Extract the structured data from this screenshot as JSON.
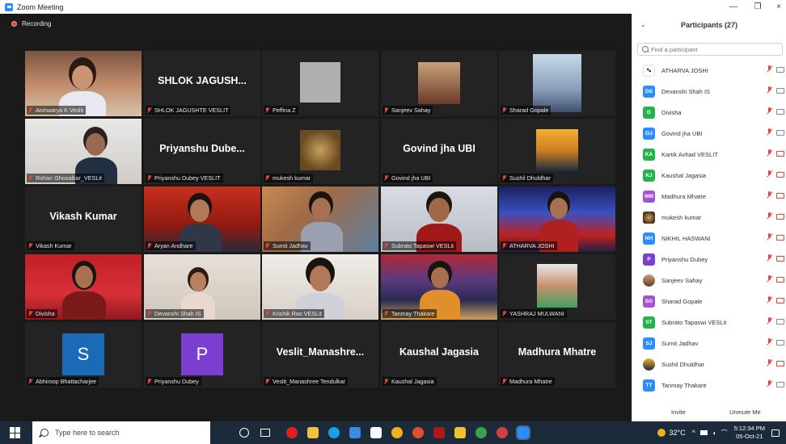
{
  "window": {
    "title": "Zoom Meeting",
    "minimize": "—",
    "restore": "❐",
    "close": "×"
  },
  "recording": {
    "label": "Recording"
  },
  "tiles": [
    {
      "name": "Aishwarya K Veslit",
      "big": ""
    },
    {
      "name": "SHLOK JAGUSHTE VESLIT",
      "big": "SHLOK JAGUSH..."
    },
    {
      "name": "Peffina Z",
      "big": ""
    },
    {
      "name": "Sanjeev Sahay",
      "big": ""
    },
    {
      "name": "Sharad Gopale",
      "big": ""
    },
    {
      "name": "Rohan Ghosalkar_VESLit",
      "big": ""
    },
    {
      "name": "Priyanshu Dubey VESLIT",
      "big": "Priyanshu  Dube..."
    },
    {
      "name": "mukesh kumar",
      "big": ""
    },
    {
      "name": "Govind jha UBI",
      "big": "Govind jha UBI"
    },
    {
      "name": "Sushil Dhuldhar",
      "big": ""
    },
    {
      "name": "Vikash Kumar",
      "big": "Vikash Kumar"
    },
    {
      "name": "Aryan Andhare",
      "big": ""
    },
    {
      "name": "Sumit Jadhav",
      "big": ""
    },
    {
      "name": "Subrato Tapaswi VESLit",
      "big": ""
    },
    {
      "name": "ATHARVA JOSHI",
      "big": ""
    },
    {
      "name": "Divisha",
      "big": ""
    },
    {
      "name": "Devanshi Shah IS",
      "big": ""
    },
    {
      "name": "Krishik Rao VESLit",
      "big": ""
    },
    {
      "name": "Tanmay Thakare",
      "big": ""
    },
    {
      "name": "YASHRAJ MULWANI",
      "big": ""
    },
    {
      "name": "Abhiroop Bhattacharjee",
      "big": "",
      "avatar": "S"
    },
    {
      "name": "Priyanshu Dubey",
      "big": "",
      "avatar": "P"
    },
    {
      "name": "Veslit_Manashree Tendulkar",
      "big": "Veslit_Manashre..."
    },
    {
      "name": "Kaushal Jagasia",
      "big": "Kaushal Jagasia"
    },
    {
      "name": "Madhura Mhatre",
      "big": "Madhura Mhatre"
    }
  ],
  "participants": {
    "title": "Participants (27)",
    "search_placeholder": "Find a participant",
    "list": [
      {
        "initials": "",
        "name": "ATHARVA JOSHI",
        "color": "#ffffff",
        "cam": "off"
      },
      {
        "initials": "DS",
        "name": "Devanshi Shah IS",
        "color": "#2d8cff",
        "cam": "off"
      },
      {
        "initials": "D",
        "name": "Divisha",
        "color": "#25b34b",
        "cam": "off"
      },
      {
        "initials": "GJ",
        "name": "Govind jha UBI",
        "color": "#2d8cff",
        "cam": "off"
      },
      {
        "initials": "KA",
        "name": "Kartik Avhad VESLIT",
        "color": "#25b34b",
        "cam": "red"
      },
      {
        "initials": "KJ",
        "name": "Kaushal Jagasia",
        "color": "#25b34b",
        "cam": "red"
      },
      {
        "initials": "MM",
        "name": "Madhura Mhatre",
        "color": "#a453d6",
        "cam": "red"
      },
      {
        "initials": "",
        "name": "mukesh kumar",
        "color": "#5a4630",
        "cam": "red"
      },
      {
        "initials": "NH",
        "name": "NIKHIL HASWANI",
        "color": "#2d8cff",
        "cam": "red"
      },
      {
        "initials": "P",
        "name": "Priyanshu Dubey",
        "color": "#7b3fd0",
        "cam": "red"
      },
      {
        "initials": "",
        "name": "Sanjeev Sahay",
        "color": "#8a6a5a",
        "cam": "red"
      },
      {
        "initials": "SG",
        "name": "Sharad Gopale",
        "color": "#a453d6",
        "cam": "red"
      },
      {
        "initials": "ST",
        "name": "Subrato Tapaswi VESLit",
        "color": "#25b34b",
        "cam": "off"
      },
      {
        "initials": "SJ",
        "name": "Sumit Jadhav",
        "color": "#2d8cff",
        "cam": "off"
      },
      {
        "initials": "",
        "name": "Sushil Dhuldhar",
        "color": "#6a5040",
        "cam": "red"
      },
      {
        "initials": "TT",
        "name": "Tanmay Thakare",
        "color": "#2d8cff",
        "cam": "off"
      }
    ],
    "invite": "Invite",
    "unmute": "Unmute Me"
  },
  "taskbar": {
    "search": "Type here to search",
    "temp": "32°C",
    "time": "5:12:34 PM",
    "date": "05-Oct-21"
  }
}
